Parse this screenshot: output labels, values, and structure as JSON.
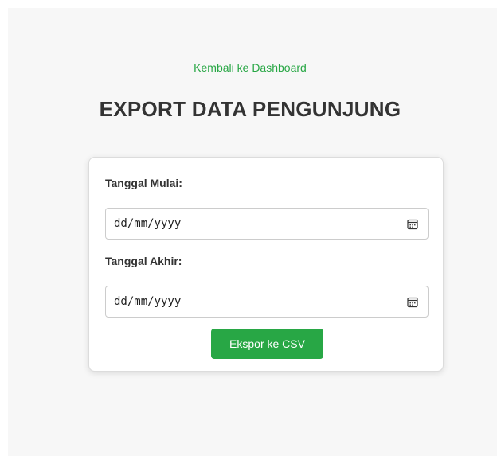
{
  "nav": {
    "back_link": "Kembali ke Dashboard"
  },
  "page": {
    "title": "EXPORT DATA PENGUNJUNG"
  },
  "form": {
    "start_date": {
      "label": "Tanggal Mulai:",
      "value": "dd/mm/yyyy",
      "icon": "calendar-icon"
    },
    "end_date": {
      "label": "Tanggal Akhir:",
      "value": "dd/mm/yyyy",
      "icon": "calendar-icon"
    },
    "submit_label": "Ekspor ke CSV"
  },
  "colors": {
    "accent": "#28a745",
    "background": "#f7f7f7",
    "card": "#ffffff",
    "title": "#333333"
  }
}
